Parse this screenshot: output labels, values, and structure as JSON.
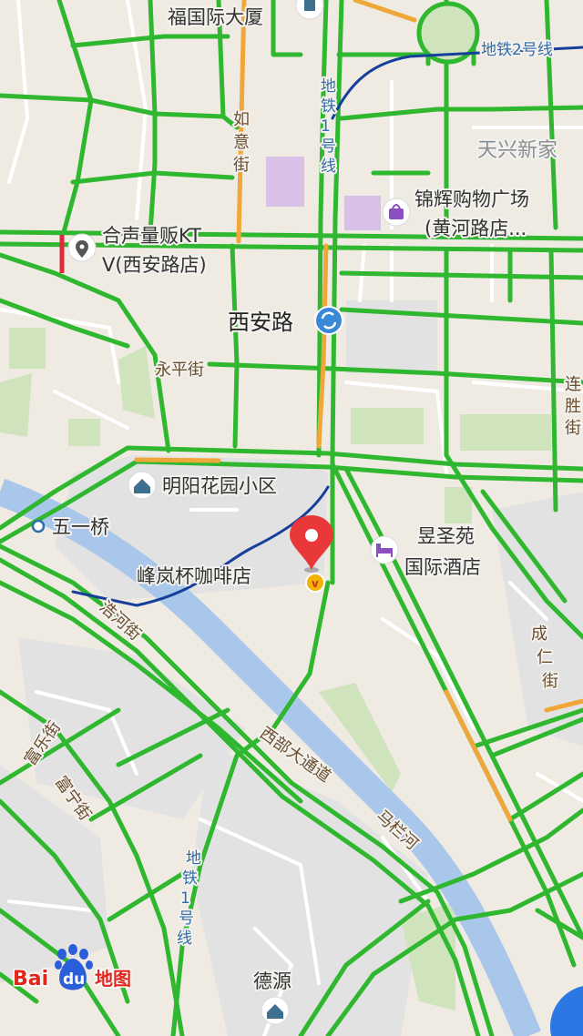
{
  "map": {
    "pois": {
      "fuguoji": "福国际大厦",
      "jinhui_1": "锦辉购物广场",
      "jinhui_2": "(黄河路店...",
      "ktv_1": "合声量贩KT",
      "ktv_2": "V(西安路店)",
      "mingyang": "明阳花园小区",
      "wuyiqiao": "五一桥",
      "yushengyuan_1": "昱圣苑",
      "yushengyuan_2": "国际酒店",
      "cafe": "峰岚杯咖啡店",
      "deyuan": "德源"
    },
    "areas": {
      "tianxing": "天兴新家"
    },
    "stations": {
      "xianlu": "西安路"
    },
    "roads": {
      "ruyi": [
        "如",
        "意",
        "街"
      ],
      "yongping": "永平街",
      "lianshengjie": [
        "连",
        "胜",
        "街"
      ],
      "chengrenjie": [
        "成",
        "仁",
        "街"
      ],
      "haohe": "浩河街",
      "fule": "富乐街",
      "funing": "富宁街",
      "xibu": "西部大通道",
      "malanhe": "马栏河"
    },
    "metro": {
      "line2": "地铁2号线",
      "line1_top": [
        "地",
        "铁",
        "1",
        "号",
        "线"
      ],
      "line1_bottom": [
        "地",
        "铁",
        "1",
        "号",
        "线"
      ]
    },
    "brand": {
      "bai": "Bai",
      "du": "du",
      "ditu": "地图"
    },
    "colors": {
      "traffic_green": "#2fb72f",
      "traffic_orange": "#f0a73a",
      "traffic_red": "#e0283a",
      "river": "#a9c7ea",
      "metro_line": "#163f9c",
      "marker": "#e8383a",
      "station_badge": "#3a89d6",
      "brand_red": "#e1261c",
      "brand_blue": "#2b5fd9"
    }
  }
}
